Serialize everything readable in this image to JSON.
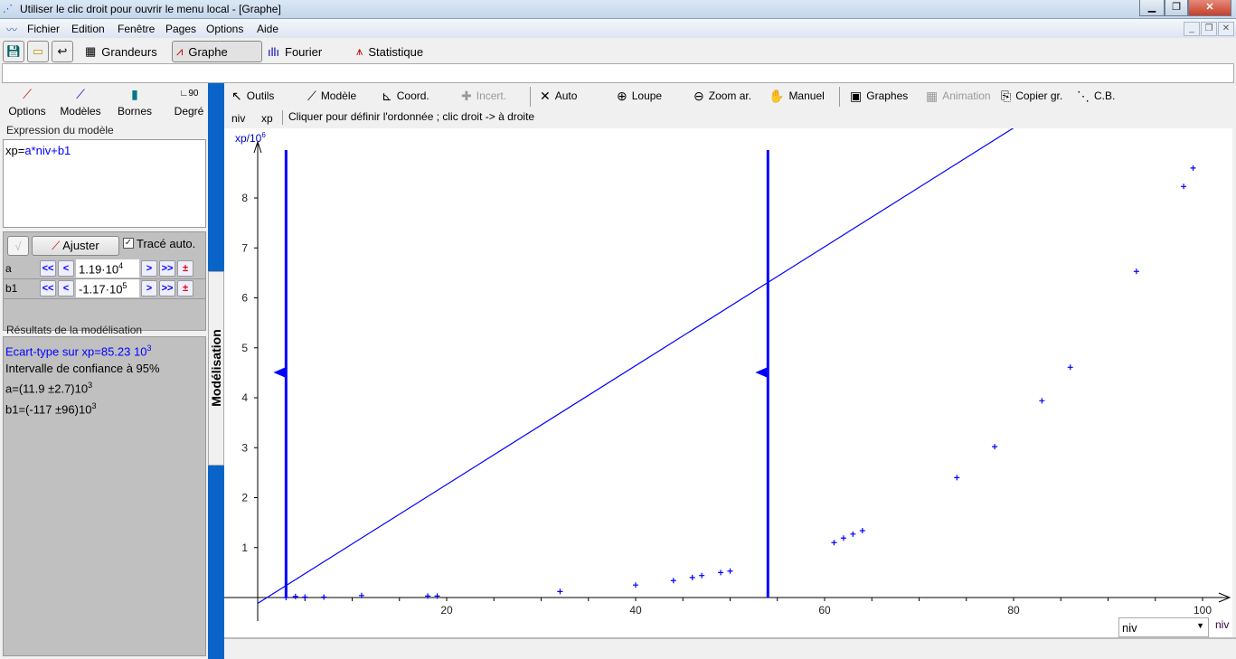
{
  "window": {
    "title": "Utiliser le clic droit pour ouvrir le menu local - [Graphe]"
  },
  "menu": [
    "Fichier",
    "Edition",
    "Fenêtre",
    "Pages",
    "Options",
    "Aide"
  ],
  "toolbar": {
    "grandeurs": "Grandeurs",
    "graphe": "Graphe",
    "fourier": "Fourier",
    "statistique": "Statistique"
  },
  "left_tools": [
    "Options",
    "Modèles",
    "Bornes",
    "Degré"
  ],
  "degre_icon_text": "90",
  "expression": {
    "label": "Expression du modèle",
    "prefix": "xp=",
    "rest": "a*niv+b1"
  },
  "params": {
    "check_icon": "√",
    "ajuster": "Ajuster",
    "trace_auto": "Tracé auto.",
    "rows": [
      {
        "name": "a",
        "mant": "1.19·10",
        "exp": "4"
      },
      {
        "name": "b1",
        "mant": "-1.17·10",
        "exp": "5"
      }
    ],
    "btn_ff_back": "<<",
    "btn_back": "<",
    "btn_fwd": ">",
    "btn_ff": ">>",
    "btn_pm": "±"
  },
  "results": {
    "label": "Résultats de la modélisation",
    "ecart": "Ecart-type sur xp=85.23 10",
    "ecart_exp": "3",
    "conf": "Intervalle de confiance à 95%",
    "a": "a=(11.9 ±2.7)10",
    "a_exp": "3",
    "b1": "b1=(-117 ±96)10",
    "b1_exp": "3"
  },
  "side_tab": "Modélisation",
  "graph_tools": [
    {
      "label": "Outils",
      "icon": "↖",
      "enabled": true
    },
    {
      "label": "Modèle",
      "icon": "⟋",
      "enabled": true
    },
    {
      "label": "Coord.",
      "icon": "⊾",
      "enabled": true
    },
    {
      "label": "Incert.",
      "icon": "✚",
      "enabled": false
    },
    {
      "label": "Auto",
      "icon": "✕",
      "enabled": true
    },
    {
      "label": "Loupe",
      "icon": "⊕",
      "enabled": true
    },
    {
      "label": "Zoom ar.",
      "icon": "⊖",
      "enabled": true
    },
    {
      "label": "Manuel",
      "icon": "✋",
      "enabled": true
    },
    {
      "label": "Graphes",
      "icon": "▣",
      "enabled": true
    },
    {
      "label": "Animation",
      "icon": "▦",
      "enabled": false
    },
    {
      "label": "Copier gr.",
      "icon": "⎘",
      "enabled": true
    },
    {
      "label": "C.B.",
      "icon": "⋱",
      "enabled": true
    }
  ],
  "vars": {
    "x": "niv",
    "y": "xp"
  },
  "hint": "Cliquer pour définir l'ordonnée ; clic droit -> à droite",
  "x_select": "niv",
  "colors": {
    "series": "#0000ff",
    "strip": "#0a64c8"
  },
  "chart_data": {
    "type": "scatter",
    "xlabel": "niv",
    "ylabel": "xp/10",
    "ylabel_exp": "6",
    "xlim": [
      -3,
      104
    ],
    "ylim": [
      -0.3,
      9.4
    ],
    "xticks": [
      20,
      40,
      60,
      80,
      100
    ],
    "yticks": [
      1,
      2,
      3,
      4,
      5,
      6,
      7,
      8
    ],
    "points": [
      [
        3,
        0.0
      ],
      [
        4,
        0.02
      ],
      [
        5,
        0.01
      ],
      [
        7,
        0.01
      ],
      [
        11,
        0.04
      ],
      [
        18,
        0.03
      ],
      [
        19,
        0.03
      ],
      [
        32,
        0.12
      ],
      [
        40,
        0.25
      ],
      [
        44,
        0.34
      ],
      [
        46,
        0.4
      ],
      [
        47,
        0.44
      ],
      [
        49,
        0.5
      ],
      [
        50,
        0.53
      ],
      [
        61,
        1.1
      ],
      [
        62,
        1.19
      ],
      [
        63,
        1.27
      ],
      [
        64,
        1.34
      ],
      [
        74,
        2.4
      ],
      [
        78,
        3.02
      ],
      [
        83,
        3.94
      ],
      [
        86,
        4.61
      ],
      [
        93,
        6.53
      ],
      [
        98,
        8.23
      ],
      [
        99,
        8.6
      ]
    ],
    "model": {
      "a": 0.119,
      "b1": -0.117
    },
    "cursors": [
      3,
      54
    ]
  }
}
